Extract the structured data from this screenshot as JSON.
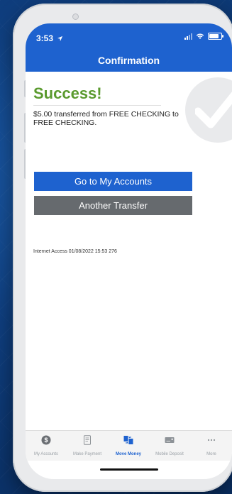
{
  "status_bar": {
    "time": "3:53"
  },
  "header": {
    "title": "Confirmation"
  },
  "confirmation": {
    "heading": "Success!",
    "message": "$5.00 transferred from FREE CHECKING to FREE CHECKING."
  },
  "buttons": {
    "primary_label": "Go to My Accounts",
    "secondary_label": "Another Transfer"
  },
  "footnote": "Internet Access 01/08/2022 15:53 276",
  "tabs": [
    {
      "label": "My Accounts",
      "icon": "dollar-circle-icon"
    },
    {
      "label": "Make Payment",
      "icon": "bill-icon"
    },
    {
      "label": "Move Money",
      "icon": "transfer-icon",
      "active": true
    },
    {
      "label": "Mobile Deposit",
      "icon": "check-deposit-icon"
    },
    {
      "label": "More",
      "icon": "more-dots-icon"
    }
  ],
  "colors": {
    "brand_blue": "#1e62cf",
    "success_green": "#5a9a2e",
    "secondary_gray": "#666a6e"
  }
}
